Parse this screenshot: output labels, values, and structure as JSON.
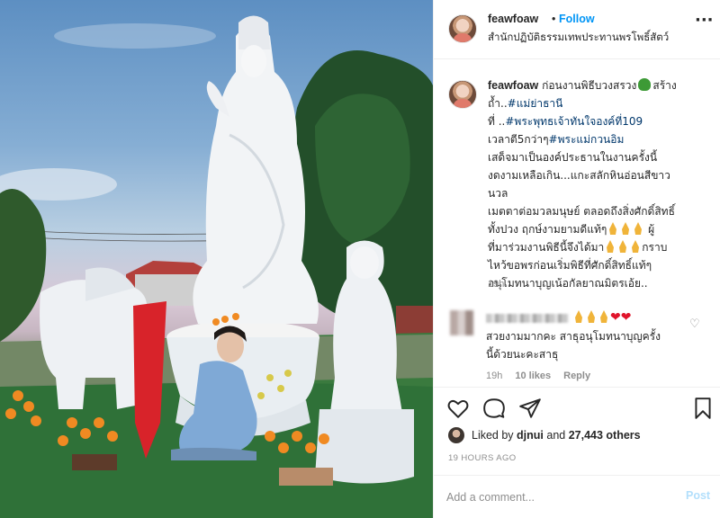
{
  "post": {
    "photo_alt": "",
    "header": {
      "username": "feawfoaw",
      "separator": "•",
      "follow_label": "Follow",
      "location": "สำนักปฏิบัติธรรมเทพประทานพรโพธิ์สัตว์",
      "more_icon": "more-options-icon",
      "more_label": "···"
    },
    "caption": {
      "username": "feawfoaw",
      "line1_pre": " ก่อนงานพิธีบวงสรวง",
      "line1_post": "สร้าง",
      "line2_pre": "ถ้ำ..",
      "tag1": "#แม่ย่าธานี",
      "line3_pre": "ที่ ..",
      "tag2": "#พระพุทธเจ้าทันใจองค์ที่109",
      "line4_pre": "เวลาตี5กว่าๆ",
      "tag3": "#พระแม่กวนอิม",
      "line5": "เสด็จมาเป็นองค์ประธานในงานครั้งนี้",
      "line6": "งดงามเหลือเกิน...แกะสลักหินอ่อนสีขาว",
      "line7": "นวล",
      "line8": "เมตตาต่อมวลมนุษย์ ตลอดถึงสิ่งศักดิ์สิทธิ์",
      "line9_pre": "ทั้งปวง ฤกษ์งามยามดีแท้ๆ",
      "line9_post": " ผู้",
      "line10_pre": "ที่มาร่วมงานพิธีนี้จึงได้มา",
      "line10_post": "กราบ",
      "line11": "ไหว้ขอพรก่อนเริ่มพิธีที่ศักดิ์สิทธิ์แท้ๆ",
      "line12": "อนุโมทนาบุญเน้อกัลยาณมิตรเอ้ย..",
      "time": "19h"
    },
    "reply": {
      "text_line1": "สวยงามมากคะ สาธุอนุโมทนาบุญครั้ง",
      "text_line2": "นี้ด้วยนะคะสาธุ",
      "time": "19h",
      "likes": "10 likes",
      "reply_label": "Reply"
    },
    "actions": {
      "like_icon": "heart-icon",
      "comment_icon": "comment-icon",
      "share_icon": "share-icon",
      "save_icon": "bookmark-icon",
      "liked_by_prefix": "Liked by ",
      "liked_by_user": "djnui",
      "liked_by_and": " and ",
      "liked_by_count": "27,443 others",
      "timestamp": "19 HOURS AGO"
    },
    "comment_box": {
      "placeholder": "Add a comment...",
      "post_label": "Post"
    }
  },
  "colors": {
    "link": "#00376b",
    "follow": "#0095f6",
    "muted": "#8e8e8e",
    "post_disabled": "#b2dffc",
    "heart": "#e0142b"
  }
}
